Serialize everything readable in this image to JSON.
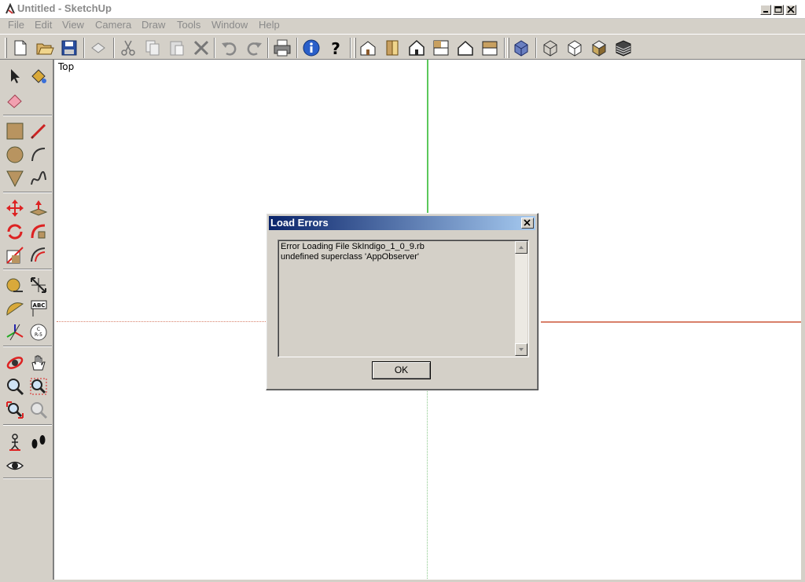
{
  "window": {
    "title": "Untitled - SketchUp",
    "icons": [
      "app-icon",
      "minimize-icon",
      "maximize-icon",
      "close-icon"
    ]
  },
  "menu": [
    "File",
    "Edit",
    "View",
    "Camera",
    "Draw",
    "Tools",
    "Window",
    "Help"
  ],
  "toolbar": {
    "icons": [
      "new-icon",
      "open-icon",
      "save-icon",
      "make-component-icon",
      "cut-icon",
      "copy-icon",
      "paste-icon",
      "erase-icon",
      "undo-icon",
      "redo-icon",
      "print-icon",
      "model-info-icon",
      "help-icon",
      "iso-view-icon",
      "front-view-icon",
      "top-view-icon",
      "right-view-icon",
      "back-view-icon",
      "left-view-icon",
      "xray-icon",
      "wireframe-icon",
      "hidden-line-icon",
      "shaded-icon",
      "shaded-textures-icon"
    ]
  },
  "toolbox": {
    "icons": [
      "select-icon",
      "paint-bucket-icon",
      "eraser-icon",
      "rectangle-icon",
      "line-icon",
      "circle-icon",
      "arc-icon",
      "polygon-icon",
      "freehand-icon",
      "move-icon",
      "push-pull-icon",
      "rotate-icon",
      "follow-me-icon",
      "scale-icon",
      "offset-icon",
      "tape-measure-icon",
      "dimension-icon",
      "protractor-icon",
      "text-icon",
      "axes-icon",
      "3d-text-icon",
      "orbit-icon",
      "pan-icon",
      "zoom-icon",
      "zoom-window-icon",
      "zoom-extents-icon",
      "previous-icon",
      "position-camera-icon",
      "walk-icon",
      "look-around-icon"
    ]
  },
  "viewport": {
    "view_label": "Top",
    "axis_colors": {
      "green": "#5bc85b",
      "red": "#d8806a"
    }
  },
  "dialog": {
    "title": "Load Errors",
    "messages": [
      "Error Loading File SkIndigo_1_0_9.rb",
      "undefined superclass 'AppObserver'"
    ],
    "ok_label": "OK",
    "title_colors": [
      "#0a246a",
      "#a6caf0"
    ]
  }
}
